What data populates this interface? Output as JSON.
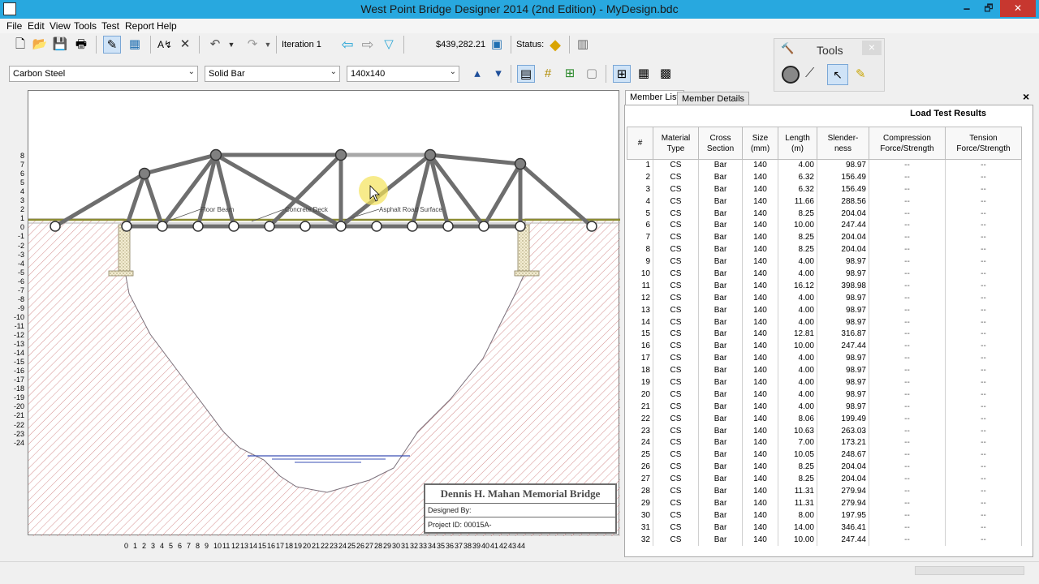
{
  "window": {
    "title": "West Point Bridge Designer 2014 (2nd Edition) - MyDesign.bdc",
    "min_symbol": "🗕",
    "max_symbol": "🗗",
    "close_symbol": "✕"
  },
  "menu": [
    "File",
    "Edit",
    "View",
    "Tools",
    "Test",
    "Report",
    "Help"
  ],
  "toolbar": {
    "iteration_label": "Iteration 1",
    "cost": "$439,282.21",
    "status_label": "Status:",
    "icons": [
      "new-file-icon",
      "open-file-icon",
      "save-icon",
      "print-icon",
      "drawing-board-icon",
      "load-test-icon",
      "auto-correct-icon",
      "delete-icon",
      "undo-icon",
      "redo-icon",
      "back-arrow-icon",
      "forward-arrow-icon",
      "dropdown-triangle-icon",
      "calculator-icon",
      "status-sign-icon",
      "report-icon"
    ]
  },
  "material_bar": {
    "material": "Carbon Steel",
    "section": "Solid Bar",
    "size": "140x140"
  },
  "tools_panel": {
    "title": "Tools",
    "close": "×"
  },
  "canvas": {
    "labels": {
      "floor_beam": "Floor Beam",
      "concrete_deck": "Concrete Deck",
      "asphalt": "Asphalt Road Surface"
    },
    "y_ticks": [
      "8",
      "7",
      "6",
      "5",
      "4",
      "3",
      "2",
      "1",
      "0",
      "-1",
      "-2",
      "-3",
      "-4",
      "-5",
      "-6",
      "-7",
      "-8",
      "-9",
      "-10",
      "-11",
      "-12",
      "-13",
      "-14",
      "-15",
      "-16",
      "-17",
      "-18",
      "-19",
      "-20",
      "-21",
      "-22",
      "-23",
      "-24"
    ],
    "x_ticks": [
      "0",
      "1",
      "2",
      "3",
      "4",
      "5",
      "6",
      "7",
      "8",
      "9",
      "10",
      "11",
      "12",
      "13",
      "14",
      "15",
      "16",
      "17",
      "18",
      "19",
      "20",
      "21",
      "22",
      "23",
      "24",
      "25",
      "26",
      "27",
      "28",
      "29",
      "30",
      "31",
      "32",
      "33",
      "34",
      "35",
      "36",
      "37",
      "38",
      "39",
      "40",
      "41",
      "42",
      "43",
      "44"
    ],
    "title_block": {
      "bridge_name": "Dennis H. Mahan Memorial Bridge",
      "designed_by": "Designed By:",
      "project_id": "Project ID: 00015A-"
    }
  },
  "tabs": {
    "member_list": "Member List",
    "member_details": "Member Details",
    "close": "×"
  },
  "table": {
    "title": "Load Test Results",
    "headers": [
      "#",
      "Material\nType",
      "Cross\nSection",
      "Size\n(mm)",
      "Length\n(m)",
      "Slender-\nness",
      "Compression\nForce/Strength",
      "Tension\nForce/Strength"
    ],
    "rows": [
      [
        "1",
        "CS",
        "Bar",
        "140",
        "4.00",
        "98.97",
        "--",
        "--"
      ],
      [
        "2",
        "CS",
        "Bar",
        "140",
        "6.32",
        "156.49",
        "--",
        "--"
      ],
      [
        "3",
        "CS",
        "Bar",
        "140",
        "6.32",
        "156.49",
        "--",
        "--"
      ],
      [
        "4",
        "CS",
        "Bar",
        "140",
        "11.66",
        "288.56",
        "--",
        "--"
      ],
      [
        "5",
        "CS",
        "Bar",
        "140",
        "8.25",
        "204.04",
        "--",
        "--"
      ],
      [
        "6",
        "CS",
        "Bar",
        "140",
        "10.00",
        "247.44",
        "--",
        "--"
      ],
      [
        "7",
        "CS",
        "Bar",
        "140",
        "8.25",
        "204.04",
        "--",
        "--"
      ],
      [
        "8",
        "CS",
        "Bar",
        "140",
        "8.25",
        "204.04",
        "--",
        "--"
      ],
      [
        "9",
        "CS",
        "Bar",
        "140",
        "4.00",
        "98.97",
        "--",
        "--"
      ],
      [
        "10",
        "CS",
        "Bar",
        "140",
        "4.00",
        "98.97",
        "--",
        "--"
      ],
      [
        "11",
        "CS",
        "Bar",
        "140",
        "16.12",
        "398.98",
        "--",
        "--"
      ],
      [
        "12",
        "CS",
        "Bar",
        "140",
        "4.00",
        "98.97",
        "--",
        "--"
      ],
      [
        "13",
        "CS",
        "Bar",
        "140",
        "4.00",
        "98.97",
        "--",
        "--"
      ],
      [
        "14",
        "CS",
        "Bar",
        "140",
        "4.00",
        "98.97",
        "--",
        "--"
      ],
      [
        "15",
        "CS",
        "Bar",
        "140",
        "12.81",
        "316.87",
        "--",
        "--"
      ],
      [
        "16",
        "CS",
        "Bar",
        "140",
        "10.00",
        "247.44",
        "--",
        "--"
      ],
      [
        "17",
        "CS",
        "Bar",
        "140",
        "4.00",
        "98.97",
        "--",
        "--"
      ],
      [
        "18",
        "CS",
        "Bar",
        "140",
        "4.00",
        "98.97",
        "--",
        "--"
      ],
      [
        "19",
        "CS",
        "Bar",
        "140",
        "4.00",
        "98.97",
        "--",
        "--"
      ],
      [
        "20",
        "CS",
        "Bar",
        "140",
        "4.00",
        "98.97",
        "--",
        "--"
      ],
      [
        "21",
        "CS",
        "Bar",
        "140",
        "4.00",
        "98.97",
        "--",
        "--"
      ],
      [
        "22",
        "CS",
        "Bar",
        "140",
        "8.06",
        "199.49",
        "--",
        "--"
      ],
      [
        "23",
        "CS",
        "Bar",
        "140",
        "10.63",
        "263.03",
        "--",
        "--"
      ],
      [
        "24",
        "CS",
        "Bar",
        "140",
        "7.00",
        "173.21",
        "--",
        "--"
      ],
      [
        "25",
        "CS",
        "Bar",
        "140",
        "10.05",
        "248.67",
        "--",
        "--"
      ],
      [
        "26",
        "CS",
        "Bar",
        "140",
        "8.25",
        "204.04",
        "--",
        "--"
      ],
      [
        "27",
        "CS",
        "Bar",
        "140",
        "8.25",
        "204.04",
        "--",
        "--"
      ],
      [
        "28",
        "CS",
        "Bar",
        "140",
        "11.31",
        "279.94",
        "--",
        "--"
      ],
      [
        "29",
        "CS",
        "Bar",
        "140",
        "11.31",
        "279.94",
        "--",
        "--"
      ],
      [
        "30",
        "CS",
        "Bar",
        "140",
        "8.00",
        "197.95",
        "--",
        "--"
      ],
      [
        "31",
        "CS",
        "Bar",
        "140",
        "14.00",
        "346.41",
        "--",
        "--"
      ],
      [
        "32",
        "CS",
        "Bar",
        "140",
        "10.00",
        "247.44",
        "--",
        "--"
      ]
    ]
  },
  "colors": {
    "titlebar": "#28a8df",
    "close": "#c7372f",
    "member": "#6e6e6e",
    "road": "#8c8c32"
  }
}
